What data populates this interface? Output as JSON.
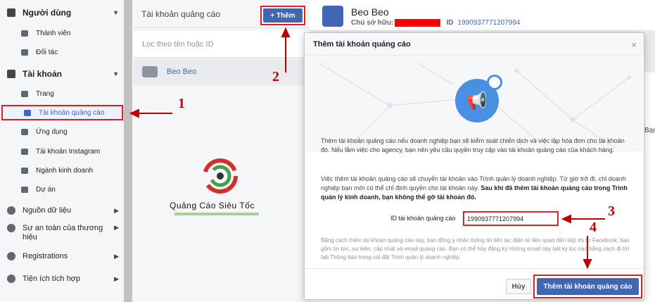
{
  "sidebar": {
    "sections": [
      {
        "label": "Người dùng",
        "icon": "people-icon",
        "items": [
          {
            "label": "Thành viên",
            "icon": "person-icon"
          },
          {
            "label": "Đối tác",
            "icon": "briefcase-icon"
          }
        ]
      },
      {
        "label": "Tài khoản",
        "icon": "briefcase-icon",
        "items": [
          {
            "label": "Trang",
            "icon": "flag-icon"
          },
          {
            "label": "Tài khoản quảng cáo",
            "icon": "ad-account-icon",
            "active": true
          },
          {
            "label": "Ứng dụng",
            "icon": "cube-icon"
          },
          {
            "label": "Tài khoản Instagram",
            "icon": "instagram-icon"
          },
          {
            "label": "Ngành kinh doanh",
            "icon": "stack-icon"
          },
          {
            "label": "Dự án",
            "icon": "folder-icon"
          }
        ]
      }
    ],
    "lower_items": [
      {
        "label": "Nguồn dữ liệu",
        "icon": "data-source-icon"
      },
      {
        "label": "Sự an toàn của thương hiệu",
        "icon": "shield-icon"
      },
      {
        "label": "Registrations",
        "icon": "list-icon"
      },
      {
        "label": "Tiện ích tích hợp",
        "icon": "integration-icon"
      }
    ]
  },
  "middle": {
    "title": "Tài khoản quảng cáo",
    "add_button": "+ Thêm",
    "filter_placeholder": "Lọc theo tên hoặc ID",
    "accounts": [
      {
        "label": "Beo Beo"
      }
    ]
  },
  "detail": {
    "name": "Beo Beo",
    "owner_label": "Chủ sở hữu:",
    "id_label": "ID",
    "id_value": "1990937771207994",
    "edge_text": "Bạn"
  },
  "dialog": {
    "title": "Thêm tài khoản quảng cáo",
    "close": "×",
    "paragraph1": "Thêm tài khoản quảng cáo nếu doanh nghiệp bạn sẽ kiểm soát chiến dịch và việc lập hóa đơn cho tài khoản đó. Nếu làm việc cho agency, bạn nên yêu cầu quyền truy cập vào tài khoản quảng cáo của khách hàng.",
    "paragraph2_normal": "Việc thêm tài khoản quảng cáo sẽ chuyển tài khoản vào Trình quản lý doanh nghiệp. Từ giờ trở đi, chỉ doanh nghiệp bạn mới có thể chỉ định quyền cho tài khoản này. ",
    "paragraph2_bold": "Sau khi đã thêm tài khoản quảng cáo trong Trình quản lý kinh doanh, bạn không thể gỡ tài khoản đó.",
    "id_field_label": "ID tài khoản quảng cáo",
    "id_field_value": "1990937771207994",
    "disclaimer": "Bằng cách thêm tài khoản quảng cáo này, bạn đồng ý nhận thông tin liên lạc điện tử liên quan đến tiếp thị từ Facebook, bao gồm tin tức, sự kiện, cập nhật và email quảng cáo. Bạn có thể hủy đăng ký những email này bất kỳ lúc nào bằng cách đi tới tab Thông báo trong cài đặt Trình quản lý doanh nghiệp.",
    "cancel_button": "Hủy",
    "submit_button": "Thêm tài khoản quảng cáo"
  },
  "watermark": {
    "text": "Quảng Cáo Siêu Tốc"
  },
  "annotations": [
    "1",
    "2",
    "3",
    "4"
  ],
  "colors": {
    "accent": "#4267b2",
    "annotation": "#c00000",
    "highlight_border": "#e02020"
  }
}
